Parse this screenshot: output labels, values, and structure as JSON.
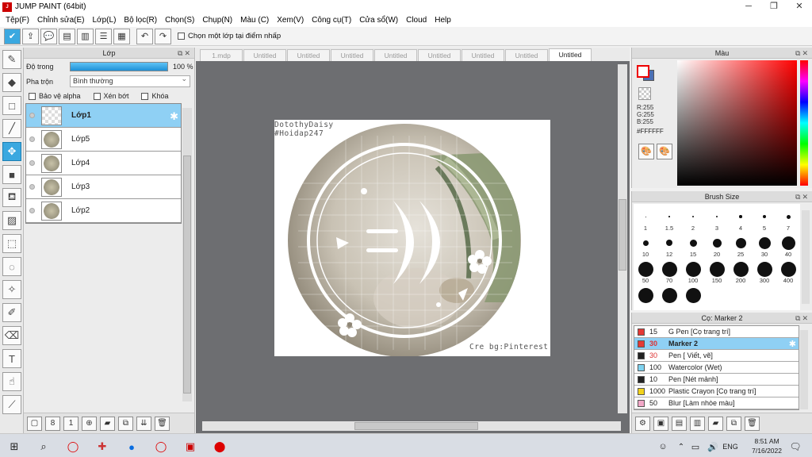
{
  "window": {
    "title": "JUMP PAINT (64bit)",
    "controls": [
      "─",
      "❐",
      "✕"
    ]
  },
  "menu": [
    "Tệp(F)",
    "Chỉnh sửa(E)",
    "Lớp(L)",
    "Bộ lọc(R)",
    "Chọn(S)",
    "Chụp(N)",
    "Màu (C)",
    "Xem(V)",
    "Công cụ(T)",
    "Cửa sổ(W)",
    "Cloud",
    "Help"
  ],
  "toolbar": {
    "checkbox_label": "Chọn một lớp tại điểm nhấp"
  },
  "layer_panel": {
    "title": "Lớp",
    "opacity_label": "Độ trong",
    "opacity_value": "100 %",
    "opacity_fraction": 1.0,
    "blend_label": "Pha trộn",
    "blend_value": "Bình thường",
    "protect_alpha": "Bảo vệ alpha",
    "clipping": "Xén bớt",
    "lock": "Khóa",
    "layers": [
      {
        "name": "Lớp1",
        "selected": true
      },
      {
        "name": "Lớp5",
        "selected": false
      },
      {
        "name": "Lớp4",
        "selected": false
      },
      {
        "name": "Lớp3",
        "selected": false
      },
      {
        "name": "Lớp2",
        "selected": false
      }
    ]
  },
  "tabs": [
    "1.mdp",
    "Untitled",
    "Untitled",
    "Untitled",
    "Untitled",
    "Untitled",
    "Untitled",
    "Untitled",
    "Untitled"
  ],
  "active_tab_index": 8,
  "canvas": {
    "watermark_line1": "DotothyDaisy",
    "watermark_line2": "#Hoidap247",
    "credit": "Cre bg:Pinterest"
  },
  "color_panel": {
    "title": "Màu",
    "r": "R:255",
    "g": "G:255",
    "b": "B:255",
    "hex": "#FFFFFF",
    "fg_color": "#FFFFFF",
    "bg_color": "#4C6FB5"
  },
  "brush_panel": {
    "title": "Brush Size",
    "sizes": [
      "1",
      "1.5",
      "2",
      "3",
      "4",
      "5",
      "7",
      "10",
      "12",
      "15",
      "20",
      "25",
      "30",
      "40",
      "50",
      "70",
      "100",
      "150",
      "200",
      "300",
      "400",
      "",
      "",
      ""
    ]
  },
  "tool_panel": {
    "title": "Cọ: Marker 2",
    "presets": [
      {
        "size": "15",
        "name": "G Pen [Cọ trang trí]",
        "color": "#E53935",
        "selected": false,
        "red": false
      },
      {
        "size": "30",
        "name": "Marker 2",
        "color": "#E53935",
        "selected": true,
        "red": true
      },
      {
        "size": "30",
        "name": "Pen [ Viết, vẽ]",
        "color": "#222222",
        "selected": false,
        "red": true
      },
      {
        "size": "100",
        "name": "Watercolor (Wet)",
        "color": "#7FD3F0",
        "selected": false,
        "red": false
      },
      {
        "size": "10",
        "name": "Pen [Nét mảnh]",
        "color": "#222222",
        "selected": false,
        "red": false
      },
      {
        "size": "1000",
        "name": "Plastic Crayon [Cọ trang trí]",
        "color": "#F2D21B",
        "selected": false,
        "red": false
      },
      {
        "size": "50",
        "name": "Blur [Làm nhòe màu]",
        "color": "#F2A8C8",
        "selected": false,
        "red": false
      }
    ]
  },
  "taskbar": {
    "lang": "ENG",
    "time": "8:51 AM",
    "date": "7/16/2022"
  }
}
